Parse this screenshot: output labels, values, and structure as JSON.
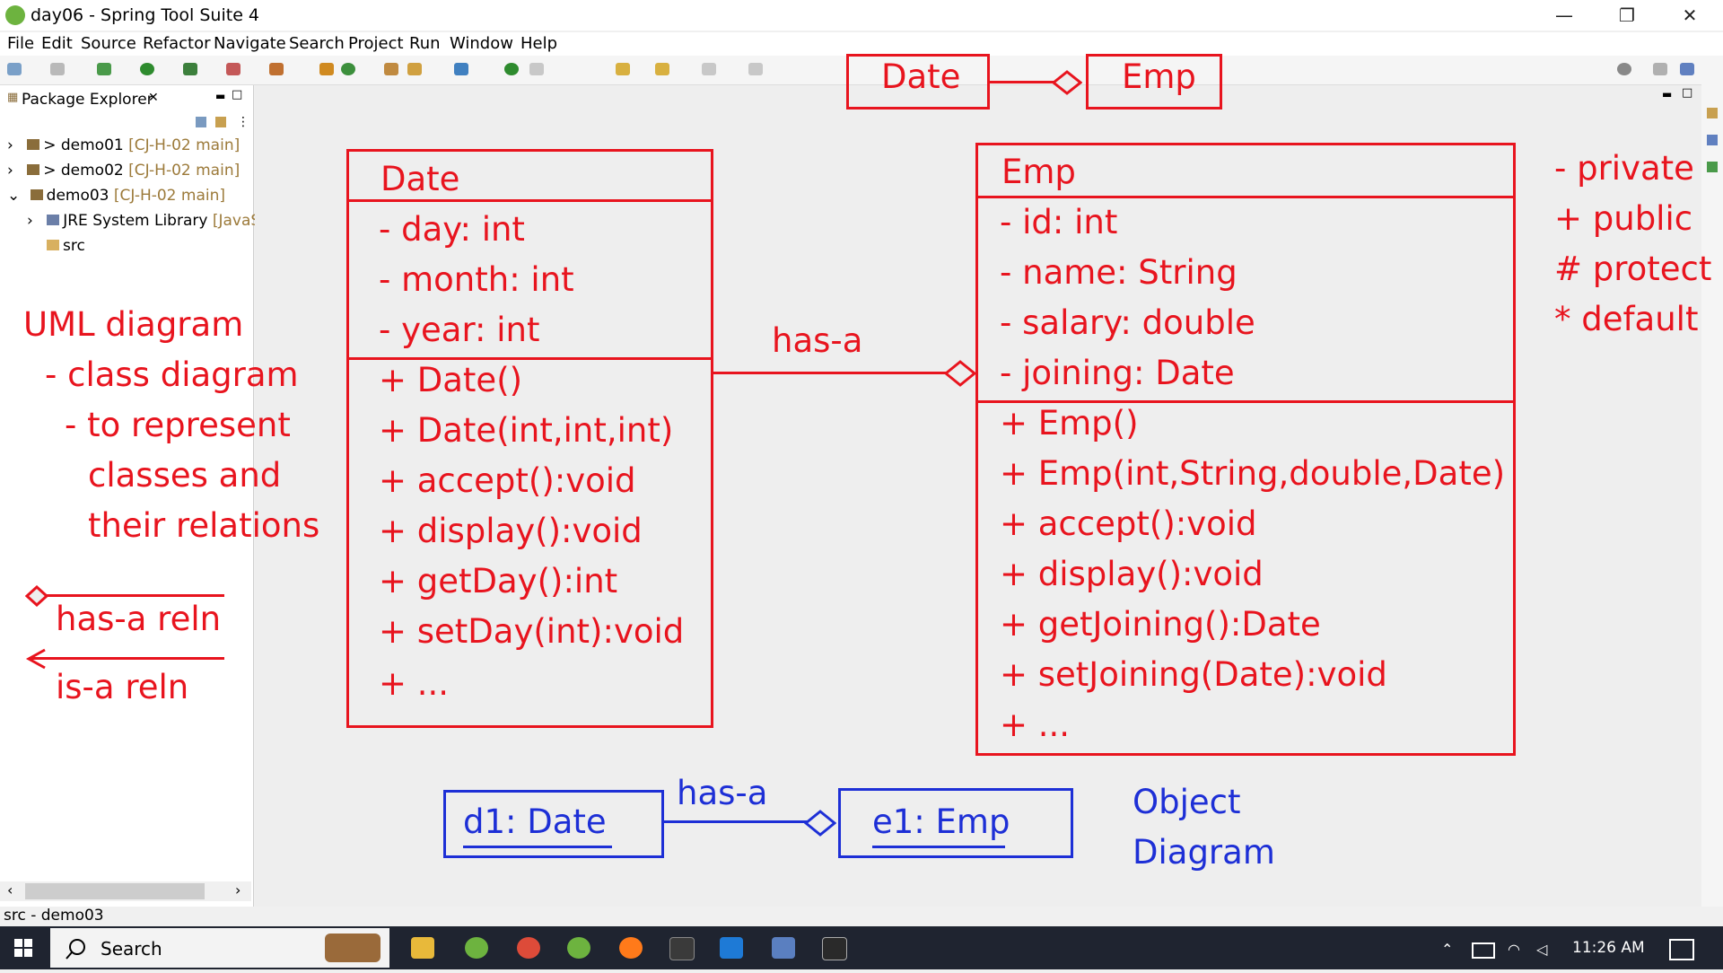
{
  "window": {
    "title": "day06 - Spring Tool Suite 4",
    "controls": {
      "minimize": "—",
      "restore": "❐",
      "close": "✕"
    }
  },
  "menu": [
    "File",
    "Edit",
    "Source",
    "Refactor",
    "Navigate",
    "Search",
    "Project",
    "Run",
    "Window",
    "Help"
  ],
  "package_explorer": {
    "tab_label": "Package Explorer",
    "close_glyph": "✕",
    "items": [
      {
        "arrow": "›",
        "prefix": "> ",
        "name": "demo01",
        "decoration": " [CJ-H-02 main]"
      },
      {
        "arrow": "›",
        "prefix": "> ",
        "name": "demo02",
        "decoration": " [CJ-H-02 main]"
      },
      {
        "arrow": "⌄",
        "prefix": "",
        "name": "demo03",
        "decoration": " [CJ-H-02 main]"
      },
      {
        "arrow": "›",
        "prefix": "",
        "name": "JRE System Library",
        "decoration": " [JavaSE"
      },
      {
        "arrow": "",
        "prefix": "",
        "name": "src",
        "decoration": ""
      }
    ]
  },
  "status_bar": {
    "text": "src - demo03"
  },
  "taskbar": {
    "search_placeholder": "Search",
    "clock": "11:26 AM"
  },
  "annotations": {
    "header_date": "Date",
    "header_emp": "Emp",
    "uml_notes": [
      "UML diagram",
      "- class diagram",
      "- to represent",
      "classes and",
      "their relations"
    ],
    "has_a_reln": "has-a reln",
    "is_a_reln": "is-a reln",
    "date_class": {
      "name": "Date",
      "fields": [
        "- day: int",
        "- month: int",
        "- year: int"
      ],
      "methods": [
        "+ Date()",
        "+ Date(int,int,int)",
        "+ accept():void",
        "+ display():void",
        "+ getDay():int",
        "+ setDay(int):void",
        "+ ..."
      ]
    },
    "emp_class": {
      "name": "Emp",
      "fields": [
        "- id: int",
        "- name: String",
        "- salary: double",
        "- joining: Date"
      ],
      "methods": [
        "+ Emp()",
        "+ Emp(int,String,double,Date)",
        "+ accept():void",
        "+ display():void",
        "+ getJoining():Date",
        "+ setJoining(Date):void",
        "+ ..."
      ]
    },
    "has_a": "has-a",
    "access_modifiers": [
      "- private",
      "+ public",
      "# protect",
      "* default"
    ],
    "object_d1": "d1: Date",
    "object_e1": "e1: Emp",
    "object_has_a": "has-a",
    "object_diagram": [
      "Object",
      "Diagram"
    ],
    "colors": {
      "red": "#e8141e",
      "blue": "#1d2fd6"
    }
  }
}
